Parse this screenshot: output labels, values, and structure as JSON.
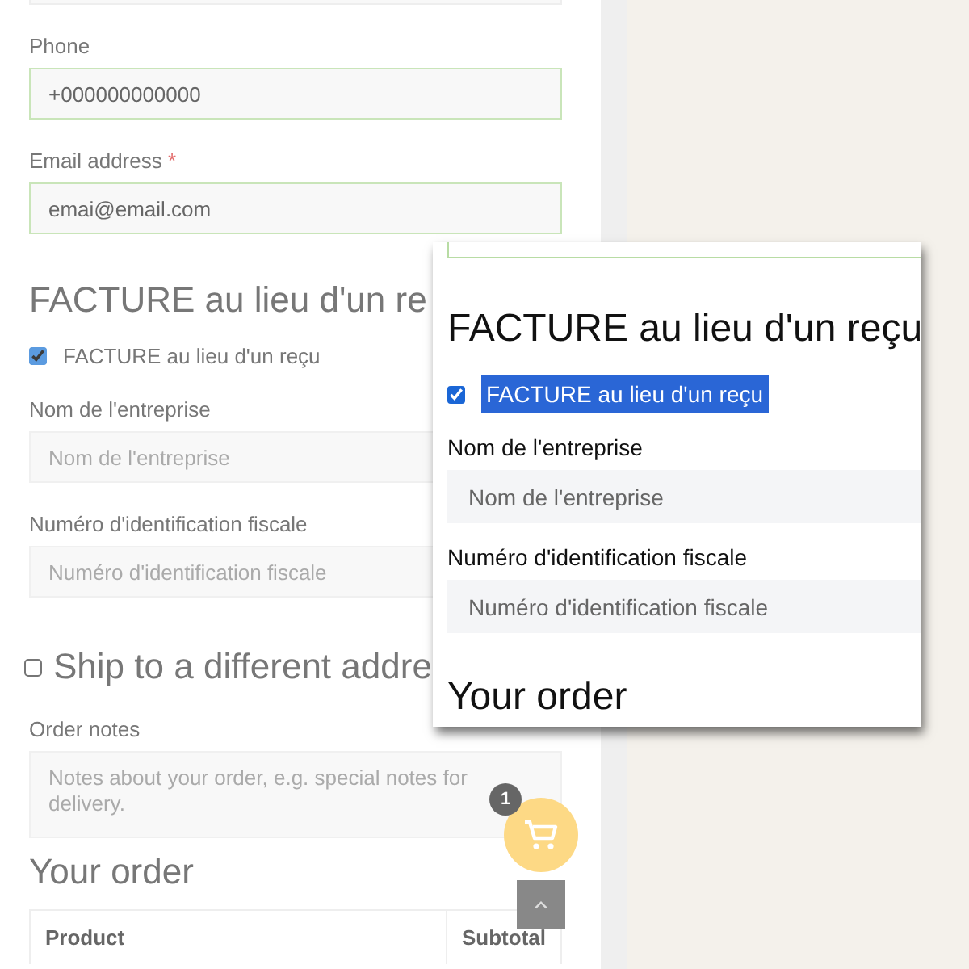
{
  "billing_fields": [
    {
      "label": "Phone",
      "value": "+000000000000"
    },
    {
      "label": "Email address",
      "required_mark": "*",
      "value": "emai@email.com"
    }
  ],
  "invoice_section": {
    "heading": "FACTURE au lieu d'un re",
    "checkbox": {
      "label": "FACTURE au lieu d'un reçu",
      "checked": true
    },
    "fields": [
      {
        "label": "Nom de l'entreprise",
        "placeholder": "Nom de l'entreprise"
      },
      {
        "label": "Numéro d'identification fiscale",
        "placeholder": "Numéro d'identification fiscale"
      }
    ]
  },
  "ship_to_different": {
    "label": "Ship to a different addre",
    "checked": false
  },
  "order_notes": {
    "label": "Order notes",
    "placeholder": "Notes about your order, e.g. special notes for delivery."
  },
  "order": {
    "heading": "Your order",
    "columns": [
      "Product",
      "Subtotal"
    ]
  },
  "cart": {
    "count": "1"
  },
  "zoom_overlay": {
    "heading": "FACTURE au lieu d'un reçu",
    "checkbox": {
      "label": "FACTURE au lieu d'un reçu",
      "checked": true,
      "highlighted": true
    },
    "fields": [
      {
        "label": "Nom de l'entreprise",
        "placeholder": "Nom de l'entreprise"
      },
      {
        "label": "Numéro d'identification fiscale",
        "placeholder": "Numéro d'identification fiscale"
      }
    ],
    "next_heading": "Your order"
  }
}
